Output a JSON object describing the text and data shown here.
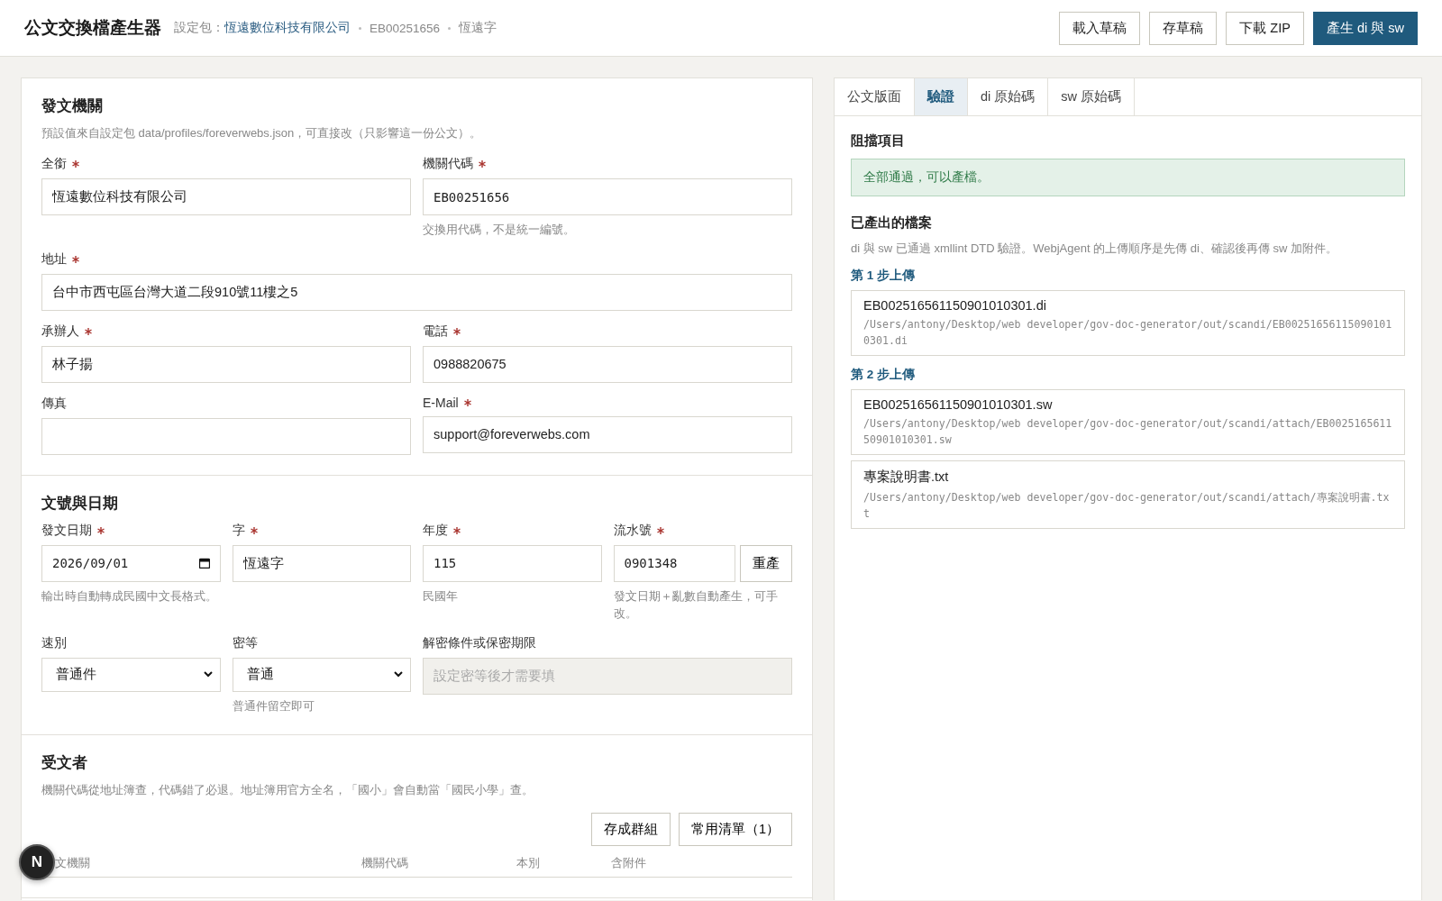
{
  "header": {
    "title": "公文交換檔產生器",
    "profile_label": "設定包：",
    "profile_name": "恆遠數位科技有限公司",
    "code": "EB00251656",
    "word": "恆遠字",
    "buttons": [
      {
        "label": "載入草稿",
        "kind": "plain"
      },
      {
        "label": "存草稿",
        "kind": "plain"
      },
      {
        "label": "下載 ZIP",
        "kind": "plain"
      },
      {
        "label": "產生 di 與 sw",
        "kind": "primary"
      }
    ]
  },
  "sections": [
    {
      "title": "發文機關",
      "description": "預設值來自設定包 data/profiles/foreverwebs.json，可直接改（只影響這一份公文）。",
      "fields": [
        {
          "label": "全銜",
          "required": true,
          "kind": "text",
          "value": "恆遠數位科技有限公司"
        },
        {
          "label": "機關代碼",
          "required": true,
          "kind": "mono",
          "value": "EB00251656",
          "hint": "交換用代碼，不是統一編號。"
        },
        {
          "label": "地址",
          "required": true,
          "kind": "text",
          "value": "台中市西屯區台灣大道二段910號11樓之5",
          "wide": true
        },
        {
          "label": "承辦人",
          "required": true,
          "kind": "text",
          "value": "林子揚"
        },
        {
          "label": "電話",
          "required": true,
          "kind": "text",
          "value": "0988820675"
        },
        {
          "label": "傳真",
          "required": false,
          "kind": "text"
        },
        {
          "label": "E-Mail",
          "required": true,
          "kind": "text",
          "value": "support@foreverwebs.com"
        }
      ]
    },
    {
      "title": "文號與日期",
      "fields": [
        {
          "label": "發文日期",
          "required": true,
          "kind": "date",
          "value": "2026/09/01",
          "hint": "輸出時自動轉成民國中文長格式。"
        },
        {
          "label": "字",
          "required": true,
          "kind": "text",
          "value": "恆遠字"
        },
        {
          "label": "年度",
          "required": true,
          "kind": "mono",
          "value": "115",
          "hint": "民國年"
        },
        {
          "label": "流水號",
          "required": true,
          "kind": "mono",
          "value": "0901348",
          "action": "重產",
          "hint": "發文日期＋亂數自動產生，可手改。"
        },
        {
          "label": "速別",
          "required": false,
          "kind": "select",
          "value": "普通件"
        },
        {
          "label": "密等",
          "required": false,
          "kind": "select",
          "value": "普通",
          "hint": "普通件留空即可"
        },
        {
          "label": "解密條件或保密期限",
          "required": false,
          "kind": "disabled",
          "placeholder": "設定密等後才需要填",
          "wide": true
        }
      ]
    },
    {
      "title": "受文者",
      "description": "機關代碼從地址簿查，代碼錯了必退。地址簿用官方全名，「國小」會自動當「國民小學」查。",
      "buttons": [
        "存成群組",
        "常用清單（1）"
      ],
      "table_columns": [
        "文機關",
        "機關代碼",
        "本別",
        "含附件"
      ]
    }
  ],
  "preview": {
    "tabs": [
      {
        "label": "公文版面",
        "selected": false
      },
      {
        "label": "驗證",
        "selected": true
      },
      {
        "label": "di 原始碼",
        "selected": false
      },
      {
        "label": "sw 原始碼",
        "selected": false
      }
    ],
    "blocking_title": "阻擋項目",
    "status_message": "全部通過，可以產檔。",
    "files_title": "已產出的檔案",
    "files_description": "di 與 sw 已通過 xmllint DTD 驗證。WebjAgent 的上傳順序是先傳 di、確認後再傳 sw 加附件。",
    "steps": [
      {
        "label": "第 1 步上傳",
        "files": [
          {
            "name": "EB002516561150901010301.di",
            "path": "/Users/antony/Desktop/web developer/gov-doc-generator/out/scandi/EB002516561150901010301.di"
          }
        ]
      },
      {
        "label": "第 2 步上傳",
        "files": [
          {
            "name": "EB002516561150901010301.sw",
            "path": "/Users/antony/Desktop/web developer/gov-doc-generator/out/scandi/attach/EB002516561150901010301.sw"
          },
          {
            "name": "專案說明書.txt",
            "path": "/Users/antony/Desktop/web developer/gov-doc-generator/out/scandi/attach/專案說明書.txt"
          }
        ]
      }
    ]
  },
  "floating_badge": "N"
}
